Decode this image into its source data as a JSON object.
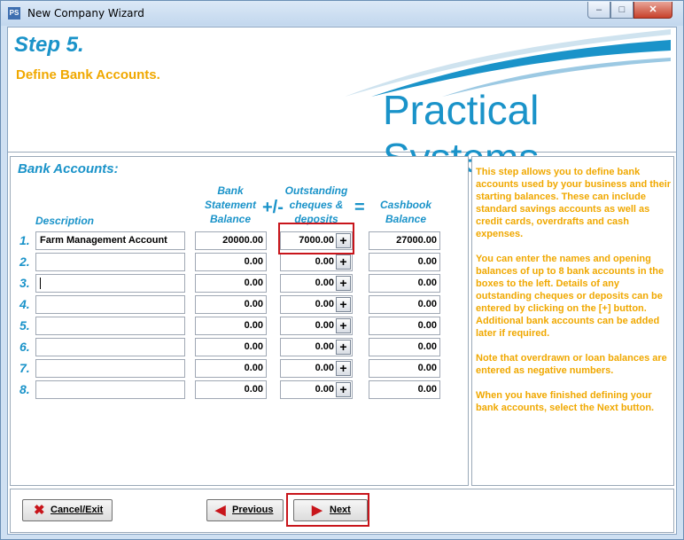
{
  "window": {
    "title": "New Company Wizard",
    "icon_text": "PS",
    "minimize": "–",
    "maximize": "□",
    "close": "✕"
  },
  "header": {
    "step": "Step 5.",
    "subtitle": "Define Bank Accounts.",
    "logo": "Practical Systems"
  },
  "form": {
    "section_title": "Bank Accounts:",
    "columns": {
      "description": "Description",
      "bank_l1": "Bank",
      "bank_l2": "Statement",
      "bank_l3": "Balance",
      "out_l1": "Outstanding",
      "out_l2": "cheques &",
      "out_l3": "deposits",
      "cash_l1": "Cashbook",
      "cash_l2": "Balance"
    },
    "ops": {
      "plusminus": "+/-",
      "equals": "="
    },
    "plus_label": "+",
    "rows": [
      {
        "num": "1.",
        "description": "Farm Management Account",
        "bank": "20000.00",
        "outstanding": "7000.00",
        "cashbook": "27000.00"
      },
      {
        "num": "2.",
        "description": "",
        "bank": "0.00",
        "outstanding": "0.00",
        "cashbook": "0.00"
      },
      {
        "num": "3.",
        "description": "",
        "bank": "0.00",
        "outstanding": "0.00",
        "cashbook": "0.00"
      },
      {
        "num": "4.",
        "description": "",
        "bank": "0.00",
        "outstanding": "0.00",
        "cashbook": "0.00"
      },
      {
        "num": "5.",
        "description": "",
        "bank": "0.00",
        "outstanding": "0.00",
        "cashbook": "0.00"
      },
      {
        "num": "6.",
        "description": "",
        "bank": "0.00",
        "outstanding": "0.00",
        "cashbook": "0.00"
      },
      {
        "num": "7.",
        "description": "",
        "bank": "0.00",
        "outstanding": "0.00",
        "cashbook": "0.00"
      },
      {
        "num": "8.",
        "description": "",
        "bank": "0.00",
        "outstanding": "0.00",
        "cashbook": "0.00"
      }
    ]
  },
  "help": {
    "p1": "This step allows you to define bank accounts used by your business and their starting balances. These can include standard savings accounts as well as credit cards, overdrafts and cash expenses.",
    "p2": "You can enter the names and opening balances of up to 8 bank accounts in the boxes to the left. Details of any outstanding cheques or deposits can be entered by clicking on the [+] button. Additional bank accounts can be added later if required.",
    "p3": "Note that overdrawn or loan balances are entered as negative numbers.",
    "p4": "When you have finished defining your bank accounts, select the Next button."
  },
  "footer": {
    "cancel": "Cancel/Exit",
    "previous": "Previous",
    "next": "Next"
  },
  "colors": {
    "accent": "#1a93c9",
    "help_text": "#f0a800",
    "highlight": "#c8151b"
  }
}
